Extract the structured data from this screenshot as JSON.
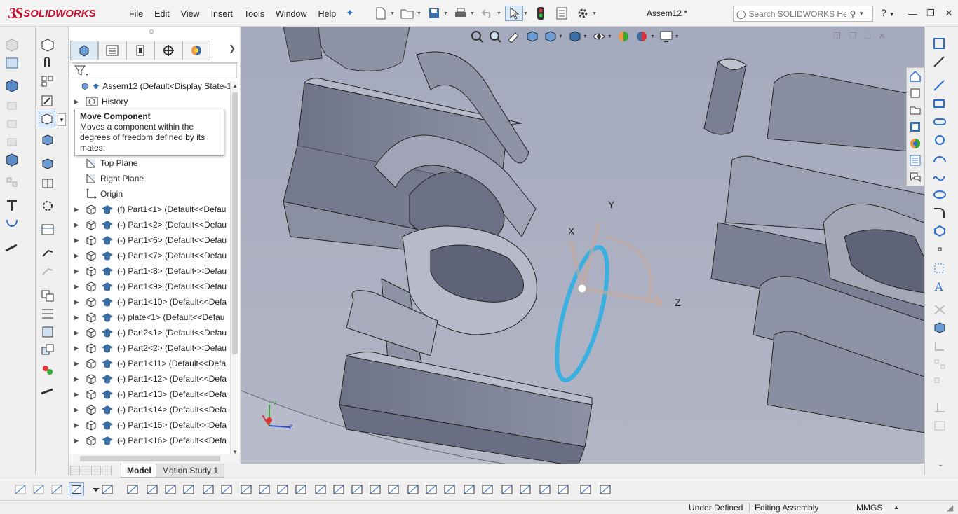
{
  "app": {
    "brand_mark": "3S",
    "brand_name": "SOLIDWORKS"
  },
  "menu": [
    "File",
    "Edit",
    "View",
    "Insert",
    "Tools",
    "Window",
    "Help"
  ],
  "document_title": "Assem12 *",
  "search": {
    "placeholder": "Search SOLIDWORKS Help"
  },
  "help_label": "?",
  "tooltip": {
    "title": "Move Component",
    "body": "Moves a component within the degrees of freedom defined by its mates."
  },
  "tree": {
    "root": "Assem12  (Default<Display State-1",
    "history": "History",
    "top_plane": "Top Plane",
    "right_plane": "Right Plane",
    "origin": "Origin",
    "components": [
      "(f) Part1<1>  (Default<<Defau",
      "(-) Part1<2>  (Default<<Defau",
      "(-) Part1<6>  (Default<<Defau",
      "(-) Part1<7>  (Default<<Defau",
      "(-) Part1<8>  (Default<<Defau",
      "(-) Part1<9>  (Default<<Defau",
      "(-) Part1<10>  (Default<<Defa",
      "(-) plate<1>  (Default<<Defau",
      "(-) Part2<1>  (Default<<Defau",
      "(-) Part2<2>  (Default<<Defau",
      "(-) Part1<11>  (Default<<Defa",
      "(-) Part1<12>  (Default<<Defa",
      "(-) Part1<13>  (Default<<Defa",
      "(-) Part1<14>  (Default<<Defa",
      "(-) Part1<15>  (Default<<Defa",
      "(-) Part1<16>  (Default<<Defa"
    ]
  },
  "triad": {
    "x": "X",
    "y": "Y",
    "z": "Z"
  },
  "bottom_tabs": {
    "model": "Model",
    "motion": "Motion Study 1"
  },
  "status": {
    "defined": "Under Defined",
    "mode": "Editing Assembly",
    "units": "MMGS",
    "units_arrow": "▲"
  },
  "colors": {
    "brand": "#c8102e",
    "viewport_bg": "#a9adbf",
    "ring": "#3ab0e0",
    "part_face": "#8e93a6"
  }
}
